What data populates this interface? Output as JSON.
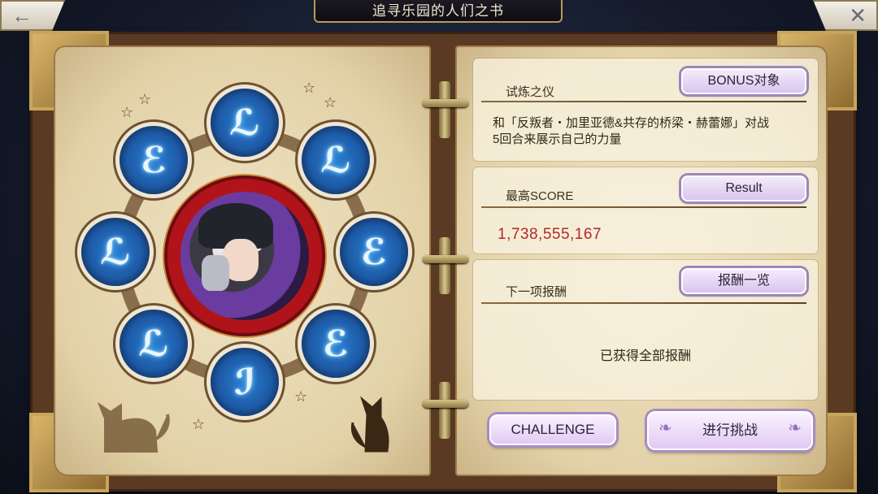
{
  "header": {
    "title": "追寻乐园的人们之书",
    "back_icon": "arrow-left",
    "close_icon": "close-x"
  },
  "emblem": {
    "medals": [
      {
        "glyph": "ℒ"
      },
      {
        "glyph": "ℒ"
      },
      {
        "glyph": "ℰ"
      },
      {
        "glyph": "ℰ"
      },
      {
        "glyph": "ℐ"
      },
      {
        "glyph": "ℒ"
      },
      {
        "glyph": "ℒ"
      },
      {
        "glyph": "ℰ"
      }
    ]
  },
  "trial": {
    "title": "试炼之仪",
    "bonus_button": "BONUS对象",
    "description_line1": "和「反叛者・加里亚德&共存的桥梁・赫蕾娜」对战",
    "description_line2": "5回合来展示自己的力量"
  },
  "score": {
    "title": "最高SCORE",
    "result_button": "Result",
    "value": "1,738,555,167",
    "value_color": "#b02a2a"
  },
  "reward": {
    "title": "下一项报酬",
    "list_button": "报酬一览",
    "message": "已获得全部报酬"
  },
  "actions": {
    "challenge_button": "CHALLENGE",
    "start_button": "进行挑战"
  }
}
